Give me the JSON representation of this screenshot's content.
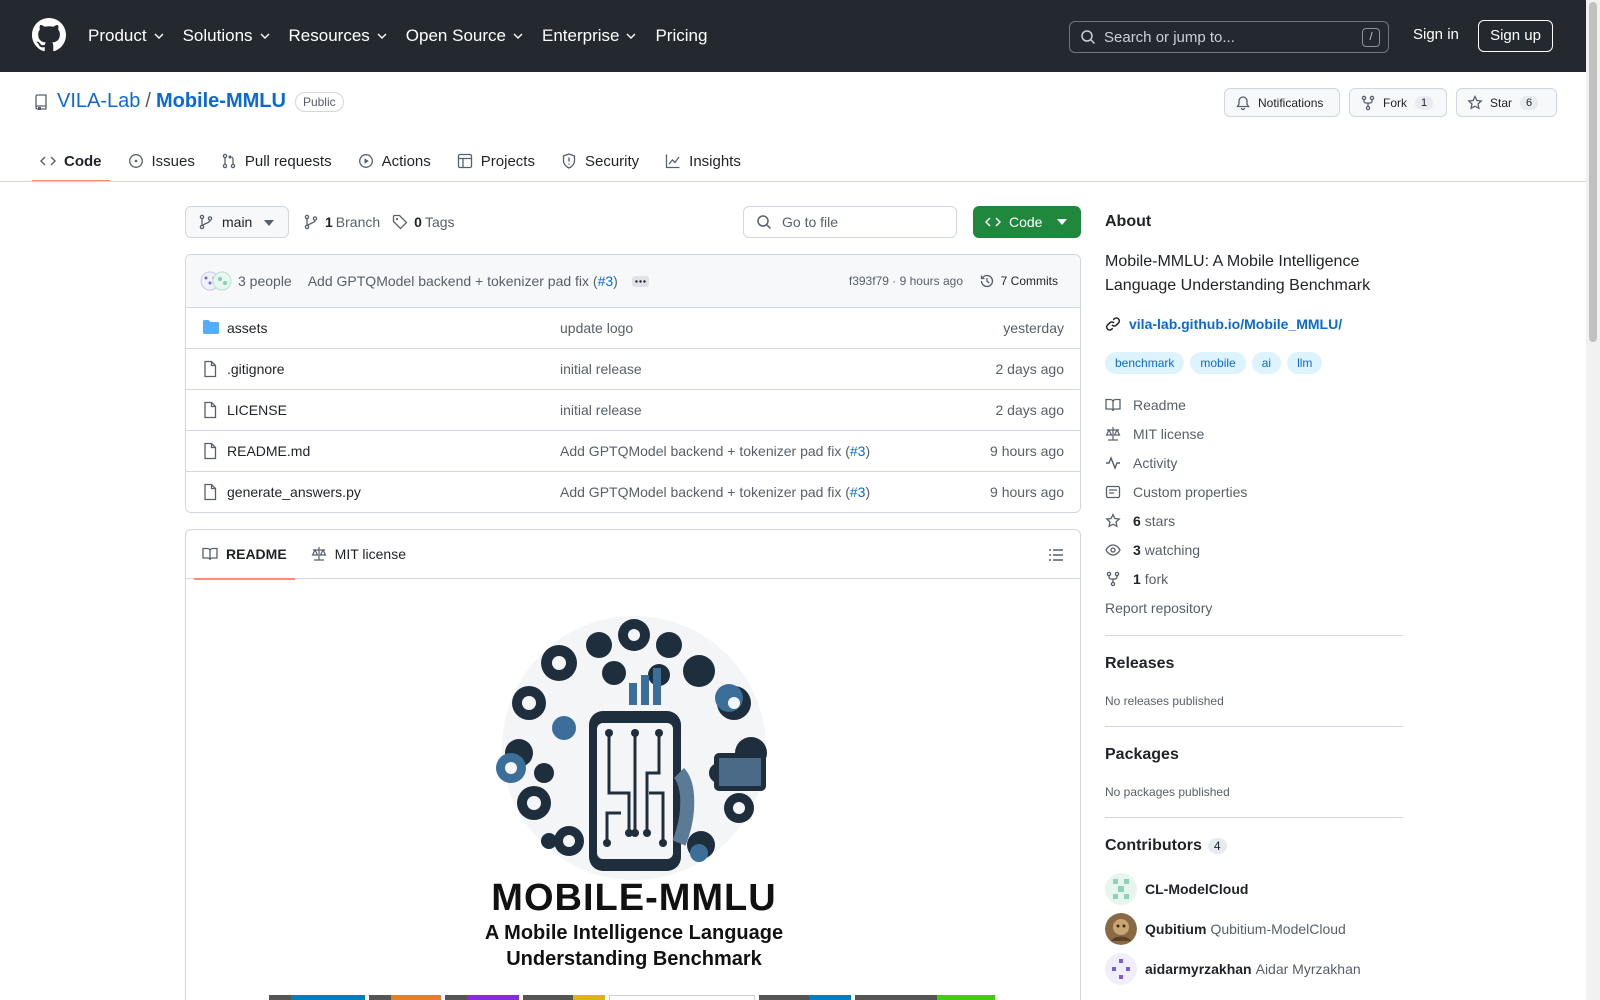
{
  "header": {
    "nav": [
      "Product",
      "Solutions",
      "Resources",
      "Open Source",
      "Enterprise",
      "Pricing"
    ],
    "search_placeholder": "Search or jump to...",
    "search_shortcut": "/",
    "signin": "Sign in",
    "signup": "Sign up"
  },
  "repo": {
    "owner": "VILA-Lab",
    "separator": "/",
    "name": "Mobile-MMLU",
    "visibility": "Public",
    "notifications": "Notifications",
    "fork_label": "Fork",
    "fork_count": "1",
    "star_label": "Star",
    "star_count": "6"
  },
  "tabs": [
    "Code",
    "Issues",
    "Pull requests",
    "Actions",
    "Projects",
    "Security",
    "Insights"
  ],
  "filebar": {
    "branch": "main",
    "branch_count": "1",
    "branch_label": "Branch",
    "tag_count": "0",
    "tag_label": "Tags",
    "goto_placeholder": "Go to file",
    "code_button": "Code"
  },
  "commit": {
    "authors": "3 people",
    "message": "Add GPTQModel backend + tokenizer pad fix (",
    "pr": "#3",
    "close": ")",
    "sha": "f393f79",
    "dot": "·",
    "time": "9 hours ago",
    "commits": "7 Commits"
  },
  "files": [
    {
      "name": "assets",
      "type": "dir",
      "msg": "update logo",
      "pr": "",
      "time": "yesterday"
    },
    {
      "name": ".gitignore",
      "type": "file",
      "msg": "initial release",
      "pr": "",
      "time": "2 days ago"
    },
    {
      "name": "LICENSE",
      "type": "file",
      "msg": "initial release",
      "pr": "",
      "time": "2 days ago"
    },
    {
      "name": "README.md",
      "type": "file",
      "msg": "Add GPTQModel backend + tokenizer pad fix (",
      "pr": "#3",
      "time": "9 hours ago"
    },
    {
      "name": "generate_answers.py",
      "type": "file",
      "msg": "Add GPTQModel backend + tokenizer pad fix (",
      "pr": "#3",
      "time": "9 hours ago"
    }
  ],
  "readme": {
    "tab_readme": "README",
    "tab_license": "MIT license",
    "title": "MOBILE-MMLU",
    "subtitle1": "A Mobile Intelligence Language",
    "subtitle2": "Understanding Benchmark"
  },
  "about": {
    "heading": "About",
    "description": "Mobile-MMLU: A Mobile Intelligence Language Understanding Benchmark",
    "link": "vila-lab.github.io/Mobile_MMLU/",
    "topics": [
      "benchmark",
      "mobile",
      "ai",
      "llm"
    ],
    "readme": "Readme",
    "license": "MIT license",
    "activity": "Activity",
    "custom_props": "Custom properties",
    "stars_count": "6",
    "stars_label": "stars",
    "watching_count": "3",
    "watching_label": "watching",
    "fork_count": "1",
    "fork_label": "fork",
    "report": "Report repository"
  },
  "releases": {
    "heading": "Releases",
    "note": "No releases published"
  },
  "packages": {
    "heading": "Packages",
    "note": "No packages published"
  },
  "contributors": {
    "heading": "Contributors",
    "count": "4",
    "list": [
      {
        "login": "CL-ModelCloud",
        "name": ""
      },
      {
        "login": "Qubitium",
        "name": "Qubitium-ModelCloud"
      },
      {
        "login": "aidarmyrzakhan",
        "name": "Aidar Myrzakhan"
      }
    ]
  },
  "colors": {
    "accent": "#0969da",
    "header": "#24292f",
    "green": "#1f883d",
    "tab_underline": "#fd8c73"
  }
}
